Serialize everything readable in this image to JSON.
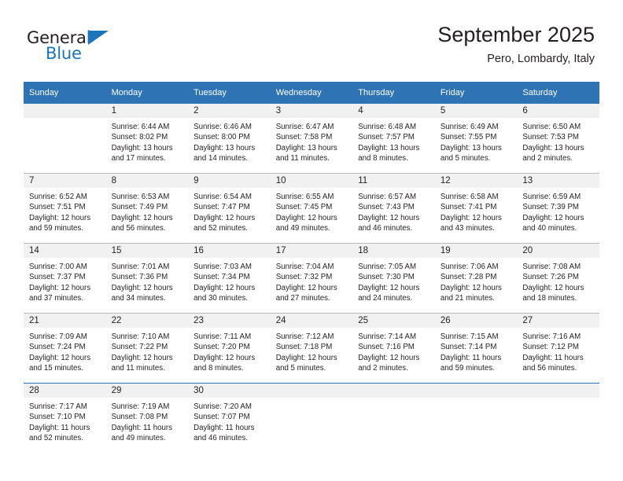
{
  "brand": {
    "name_dark": "General",
    "name_blue": "Blue",
    "triangle_icon": "triangle-icon",
    "accent_color": "#1b75bb"
  },
  "header": {
    "title": "September 2025",
    "subtitle": "Pero, Lombardy, Italy"
  },
  "colors": {
    "header_row": "#2e74b5",
    "daynum_band": "#f1f1f1",
    "grid_line": "#b9b9b9",
    "text": "#231f20"
  },
  "weekday_headers": [
    "Sunday",
    "Monday",
    "Tuesday",
    "Wednesday",
    "Thursday",
    "Friday",
    "Saturday"
  ],
  "weeks": [
    [
      {
        "day": "",
        "sunrise": "",
        "sunset": "",
        "daylight_l1": "",
        "daylight_l2": "",
        "empty": true
      },
      {
        "day": "1",
        "sunrise": "Sunrise: 6:44 AM",
        "sunset": "Sunset: 8:02 PM",
        "daylight_l1": "Daylight: 13 hours",
        "daylight_l2": "and 17 minutes."
      },
      {
        "day": "2",
        "sunrise": "Sunrise: 6:46 AM",
        "sunset": "Sunset: 8:00 PM",
        "daylight_l1": "Daylight: 13 hours",
        "daylight_l2": "and 14 minutes."
      },
      {
        "day": "3",
        "sunrise": "Sunrise: 6:47 AM",
        "sunset": "Sunset: 7:58 PM",
        "daylight_l1": "Daylight: 13 hours",
        "daylight_l2": "and 11 minutes."
      },
      {
        "day": "4",
        "sunrise": "Sunrise: 6:48 AM",
        "sunset": "Sunset: 7:57 PM",
        "daylight_l1": "Daylight: 13 hours",
        "daylight_l2": "and 8 minutes."
      },
      {
        "day": "5",
        "sunrise": "Sunrise: 6:49 AM",
        "sunset": "Sunset: 7:55 PM",
        "daylight_l1": "Daylight: 13 hours",
        "daylight_l2": "and 5 minutes."
      },
      {
        "day": "6",
        "sunrise": "Sunrise: 6:50 AM",
        "sunset": "Sunset: 7:53 PM",
        "daylight_l1": "Daylight: 13 hours",
        "daylight_l2": "and 2 minutes."
      }
    ],
    [
      {
        "day": "7",
        "sunrise": "Sunrise: 6:52 AM",
        "sunset": "Sunset: 7:51 PM",
        "daylight_l1": "Daylight: 12 hours",
        "daylight_l2": "and 59 minutes."
      },
      {
        "day": "8",
        "sunrise": "Sunrise: 6:53 AM",
        "sunset": "Sunset: 7:49 PM",
        "daylight_l1": "Daylight: 12 hours",
        "daylight_l2": "and 56 minutes."
      },
      {
        "day": "9",
        "sunrise": "Sunrise: 6:54 AM",
        "sunset": "Sunset: 7:47 PM",
        "daylight_l1": "Daylight: 12 hours",
        "daylight_l2": "and 52 minutes."
      },
      {
        "day": "10",
        "sunrise": "Sunrise: 6:55 AM",
        "sunset": "Sunset: 7:45 PM",
        "daylight_l1": "Daylight: 12 hours",
        "daylight_l2": "and 49 minutes."
      },
      {
        "day": "11",
        "sunrise": "Sunrise: 6:57 AM",
        "sunset": "Sunset: 7:43 PM",
        "daylight_l1": "Daylight: 12 hours",
        "daylight_l2": "and 46 minutes."
      },
      {
        "day": "12",
        "sunrise": "Sunrise: 6:58 AM",
        "sunset": "Sunset: 7:41 PM",
        "daylight_l1": "Daylight: 12 hours",
        "daylight_l2": "and 43 minutes."
      },
      {
        "day": "13",
        "sunrise": "Sunrise: 6:59 AM",
        "sunset": "Sunset: 7:39 PM",
        "daylight_l1": "Daylight: 12 hours",
        "daylight_l2": "and 40 minutes."
      }
    ],
    [
      {
        "day": "14",
        "sunrise": "Sunrise: 7:00 AM",
        "sunset": "Sunset: 7:37 PM",
        "daylight_l1": "Daylight: 12 hours",
        "daylight_l2": "and 37 minutes."
      },
      {
        "day": "15",
        "sunrise": "Sunrise: 7:01 AM",
        "sunset": "Sunset: 7:36 PM",
        "daylight_l1": "Daylight: 12 hours",
        "daylight_l2": "and 34 minutes."
      },
      {
        "day": "16",
        "sunrise": "Sunrise: 7:03 AM",
        "sunset": "Sunset: 7:34 PM",
        "daylight_l1": "Daylight: 12 hours",
        "daylight_l2": "and 30 minutes."
      },
      {
        "day": "17",
        "sunrise": "Sunrise: 7:04 AM",
        "sunset": "Sunset: 7:32 PM",
        "daylight_l1": "Daylight: 12 hours",
        "daylight_l2": "and 27 minutes."
      },
      {
        "day": "18",
        "sunrise": "Sunrise: 7:05 AM",
        "sunset": "Sunset: 7:30 PM",
        "daylight_l1": "Daylight: 12 hours",
        "daylight_l2": "and 24 minutes."
      },
      {
        "day": "19",
        "sunrise": "Sunrise: 7:06 AM",
        "sunset": "Sunset: 7:28 PM",
        "daylight_l1": "Daylight: 12 hours",
        "daylight_l2": "and 21 minutes."
      },
      {
        "day": "20",
        "sunrise": "Sunrise: 7:08 AM",
        "sunset": "Sunset: 7:26 PM",
        "daylight_l1": "Daylight: 12 hours",
        "daylight_l2": "and 18 minutes."
      }
    ],
    [
      {
        "day": "21",
        "sunrise": "Sunrise: 7:09 AM",
        "sunset": "Sunset: 7:24 PM",
        "daylight_l1": "Daylight: 12 hours",
        "daylight_l2": "and 15 minutes."
      },
      {
        "day": "22",
        "sunrise": "Sunrise: 7:10 AM",
        "sunset": "Sunset: 7:22 PM",
        "daylight_l1": "Daylight: 12 hours",
        "daylight_l2": "and 11 minutes."
      },
      {
        "day": "23",
        "sunrise": "Sunrise: 7:11 AM",
        "sunset": "Sunset: 7:20 PM",
        "daylight_l1": "Daylight: 12 hours",
        "daylight_l2": "and 8 minutes."
      },
      {
        "day": "24",
        "sunrise": "Sunrise: 7:12 AM",
        "sunset": "Sunset: 7:18 PM",
        "daylight_l1": "Daylight: 12 hours",
        "daylight_l2": "and 5 minutes."
      },
      {
        "day": "25",
        "sunrise": "Sunrise: 7:14 AM",
        "sunset": "Sunset: 7:16 PM",
        "daylight_l1": "Daylight: 12 hours",
        "daylight_l2": "and 2 minutes."
      },
      {
        "day": "26",
        "sunrise": "Sunrise: 7:15 AM",
        "sunset": "Sunset: 7:14 PM",
        "daylight_l1": "Daylight: 11 hours",
        "daylight_l2": "and 59 minutes."
      },
      {
        "day": "27",
        "sunrise": "Sunrise: 7:16 AM",
        "sunset": "Sunset: 7:12 PM",
        "daylight_l1": "Daylight: 11 hours",
        "daylight_l2": "and 56 minutes."
      }
    ],
    [
      {
        "day": "28",
        "sunrise": "Sunrise: 7:17 AM",
        "sunset": "Sunset: 7:10 PM",
        "daylight_l1": "Daylight: 11 hours",
        "daylight_l2": "and 52 minutes."
      },
      {
        "day": "29",
        "sunrise": "Sunrise: 7:19 AM",
        "sunset": "Sunset: 7:08 PM",
        "daylight_l1": "Daylight: 11 hours",
        "daylight_l2": "and 49 minutes."
      },
      {
        "day": "30",
        "sunrise": "Sunrise: 7:20 AM",
        "sunset": "Sunset: 7:07 PM",
        "daylight_l1": "Daylight: 11 hours",
        "daylight_l2": "and 46 minutes."
      },
      {
        "day": "",
        "sunrise": "",
        "sunset": "",
        "daylight_l1": "",
        "daylight_l2": "",
        "empty": true
      },
      {
        "day": "",
        "sunrise": "",
        "sunset": "",
        "daylight_l1": "",
        "daylight_l2": "",
        "empty": true
      },
      {
        "day": "",
        "sunrise": "",
        "sunset": "",
        "daylight_l1": "",
        "daylight_l2": "",
        "empty": true
      },
      {
        "day": "",
        "sunrise": "",
        "sunset": "",
        "daylight_l1": "",
        "daylight_l2": "",
        "empty": true
      }
    ]
  ]
}
